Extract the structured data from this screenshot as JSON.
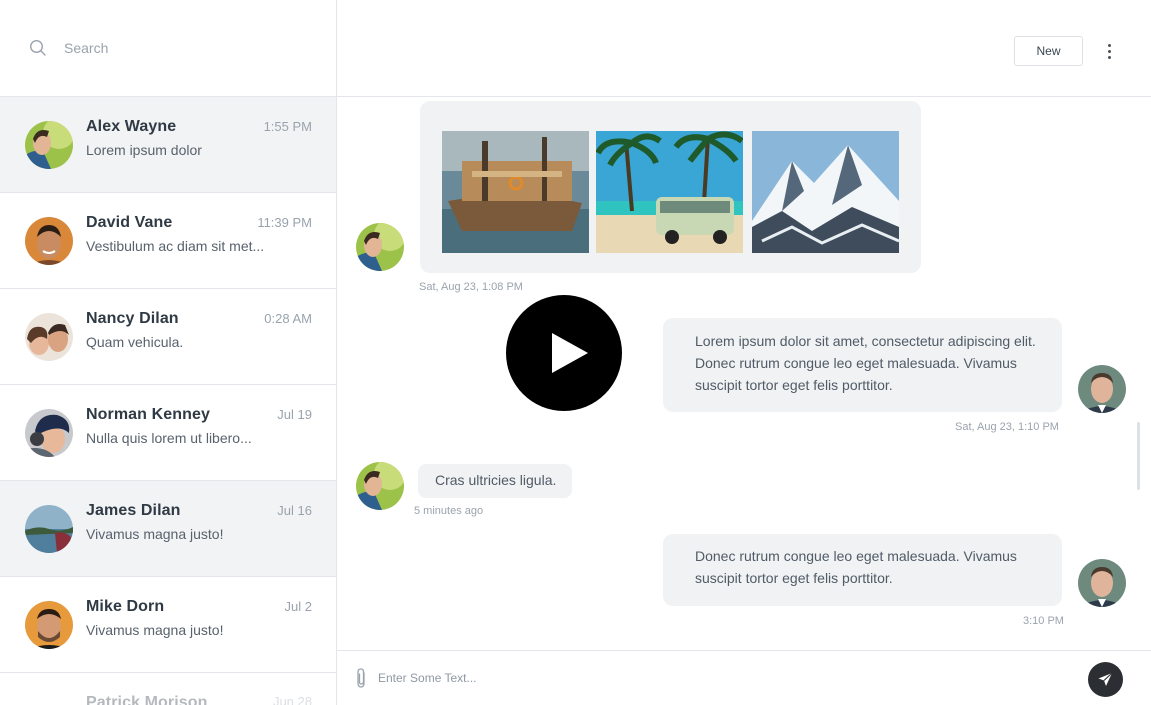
{
  "search": {
    "placeholder": "Search"
  },
  "contacts": [
    {
      "name": "Alex Wayne",
      "preview": "Lorem ipsum dolor",
      "time": "1:55 PM"
    },
    {
      "name": "David Vane",
      "preview": "Vestibulum ac diam sit met...",
      "time": "11:39 PM"
    },
    {
      "name": "Nancy Dilan",
      "preview": "Quam vehicula.",
      "time": "0:28 AM"
    },
    {
      "name": "Norman Kenney",
      "preview": "Nulla quis lorem ut libero...",
      "time": "Jul 19"
    },
    {
      "name": "James Dilan",
      "preview": "Vivamus magna justo!",
      "time": "Jul 16"
    },
    {
      "name": "Mike Dorn",
      "preview": "Vivamus magna justo!",
      "time": "Jul 2"
    },
    {
      "name": "Patrick Morison",
      "preview": "",
      "time": "Jun 28"
    }
  ],
  "header": {
    "new_label": "New"
  },
  "messages": {
    "m1_time": "Sat, Aug 23, 1:08 PM",
    "m2_text": "Lorem ipsum dolor sit amet, consectetur adipiscing elit. Donec rutrum congue leo eget malesuada. Vivamus suscipit tortor eget felis porttitor.",
    "m2_time": "Sat, Aug 23, 1:10 PM",
    "m3_text": "Cras ultricies ligula.",
    "m3_time": "5 minutes ago",
    "m4_text": "Donec rutrum congue leo eget malesuada. Vivamus suscipit tortor eget felis porttitor.",
    "m4_time": "3:10 PM"
  },
  "images": [
    "boat-photo",
    "beach-van-photo",
    "mountain-photo"
  ],
  "composer": {
    "placeholder": "Enter Some Text..."
  },
  "icons": {
    "search": "search-icon",
    "more": "more-vertical-icon",
    "play": "play-icon",
    "attach": "paperclip-icon",
    "send": "send-icon"
  }
}
